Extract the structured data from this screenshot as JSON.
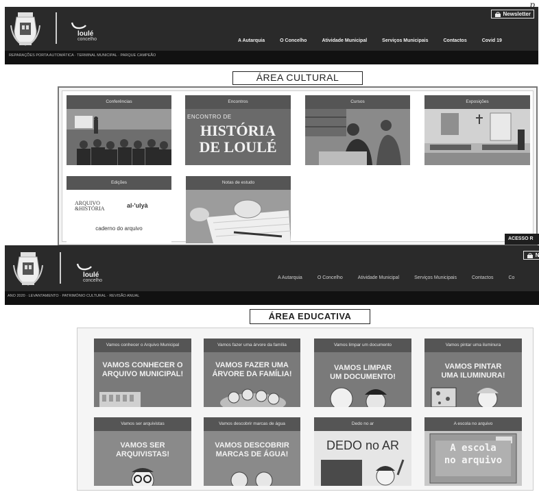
{
  "page_marker": "p",
  "header_top": {
    "newsletter_label": "Newsletter",
    "brand_name": "loulé",
    "brand_sub": "concelho",
    "nav": [
      "A Autarquia",
      "O Concelho",
      "Atividade Municipal",
      "Serviços Municipais",
      "Contactos",
      "Covid 19"
    ],
    "ticker": "REPARAÇÕES PORTA AUTOMÁTICA · TERMINAL MUNICIPAL · PARQUE CAMPEÃO"
  },
  "header_bottom": {
    "newsletter_label": "Ne",
    "brand_name": "loulé",
    "brand_sub": "concelho",
    "nav": [
      "A Autarquia",
      "O Concelho",
      "Atividade Municipal",
      "Serviços Municipais",
      "Contactos",
      "Co"
    ],
    "ticker": "ANO 2020 · LEVANTAMENTO · PATRIMÓNIO CULTURAL · REVISÃO ANUAL"
  },
  "area_cultural": {
    "title": "ÁREA CULTURAL",
    "cards": [
      {
        "label": "Conferências"
      },
      {
        "label": "Encontros",
        "image_line1": "ENCONTRO DE",
        "image_line2": "HISTÓRIA",
        "image_line3": "DE LOULÉ"
      },
      {
        "label": "Cursos"
      },
      {
        "label": "Exposições"
      },
      {
        "label": "Edições",
        "logo_left_line1": "ARQUIVO",
        "logo_left_line2": "&HISTÓRIA",
        "logo_right": "al-'ulyà",
        "caption": "caderno do arquivo"
      },
      {
        "label": "Notas de estudo"
      }
    ],
    "acesso_label": "ACESSO R"
  },
  "area_educativa": {
    "title": "ÁREA EDUCATIVA",
    "cards": [
      {
        "label": "Vamos conhecer o Arquivo Municipal",
        "image_text": [
          "VAMOS CONHECER O",
          "ARQUIVO MUNICIPAL!"
        ]
      },
      {
        "label": "Vamos fazer uma árvore da família",
        "image_text": [
          "VAMOS FAZER UMA",
          "ÁRVORE DA FAMÍLIA!"
        ]
      },
      {
        "label": "Vamos limpar um documento",
        "image_text": [
          "VAMOS LIMPAR",
          "UM DOCUMENTO!"
        ]
      },
      {
        "label": "Vamos pintar uma iluminura",
        "image_text": [
          "VAMOS PINTAR",
          "UMA ILUMINURA!"
        ]
      },
      {
        "label": "Vamos ser arquivistas",
        "image_text": [
          "VAMOS SER",
          "ARQUIVISTAS!"
        ]
      },
      {
        "label": "Vamos descobrir marcas de água",
        "image_text": [
          "VAMOS DESCOBRIR",
          "MARCAS DE ÁGUA!"
        ]
      },
      {
        "label": "Dedo no ar",
        "image_text": [
          "DEDO no AR"
        ]
      },
      {
        "label": "A escola no arquivo",
        "image_text": [
          "A escola",
          "no arquivo"
        ]
      }
    ]
  },
  "colors": {
    "header_bg": "#2a2a2a",
    "ticker_bg": "#111111",
    "card_label_bg": "#555555",
    "edu_image_bg": "#7a7a7a"
  },
  "icons": [
    "coat-of-arms-icon",
    "brand-swoosh-icon",
    "lock-icon"
  ]
}
